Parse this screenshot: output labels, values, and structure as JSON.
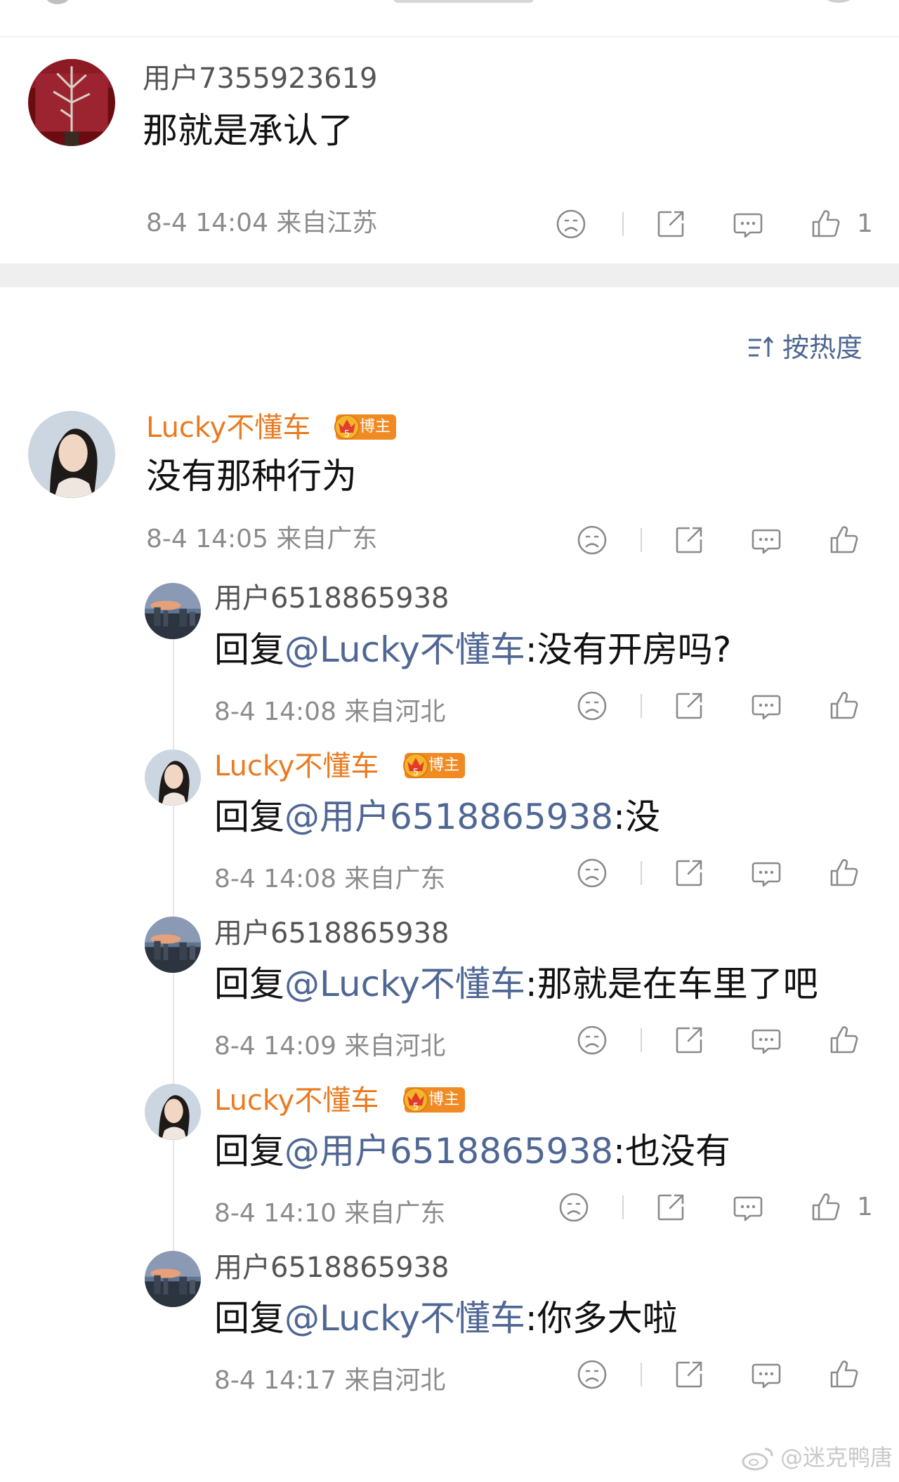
{
  "top_comment": {
    "username": "用户7355923619",
    "text": "那就是承认了",
    "meta": "8-4 14:04 来自江苏",
    "like_count": "1"
  },
  "sort": {
    "label": "按热度"
  },
  "main_comment": {
    "username": "Lucky不懂车",
    "badge": "博主",
    "text": "没有那种行为",
    "meta": "8-4 14:05 来自广东"
  },
  "replies": [
    {
      "username": "用户6518865938",
      "reply_prefix": "回复",
      "mention": "@Lucky不懂车",
      "body": ":没有开房吗?",
      "meta": "8-4 14:08 来自河北"
    },
    {
      "username": "Lucky不懂车",
      "badge": "博主",
      "reply_prefix": "回复",
      "mention": "@用户6518865938",
      "body": ":没",
      "meta": "8-4 14:08 来自广东"
    },
    {
      "username": "用户6518865938",
      "reply_prefix": "回复",
      "mention": "@Lucky不懂车",
      "body": ":那就是在车里了吧",
      "meta": "8-4 14:09 来自河北"
    },
    {
      "username": "Lucky不懂车",
      "badge": "博主",
      "reply_prefix": "回复",
      "mention": "@用户6518865938",
      "body": ":也没有",
      "meta": "8-4 14:10 来自广东",
      "like_count": "1"
    },
    {
      "username": "用户6518865938",
      "reply_prefix": "回复",
      "mention": "@Lucky不懂车",
      "body": ":你多大啦",
      "meta": "8-4 14:17 来自河北"
    }
  ],
  "watermark": {
    "text": "@迷克鸭唐"
  },
  "icons": [
    "sad-face-icon",
    "share-icon",
    "comment-icon",
    "thumbs-up-icon",
    "sort-icon",
    "crown-icon",
    "weibo-logo-icon"
  ],
  "colors": {
    "blogger_name": "#ea7a1f",
    "mention": "#4f6794",
    "meta": "#8c8c8c",
    "badge": "#f08a22"
  }
}
